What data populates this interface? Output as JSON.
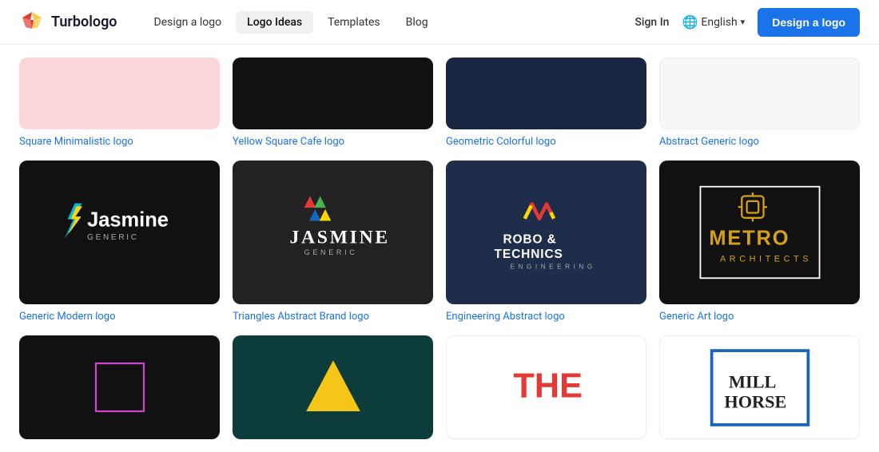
{
  "header": {
    "brand": "Turbologo",
    "nav": [
      {
        "id": "design",
        "label": "Design a logo",
        "active": false
      },
      {
        "id": "logo-ideas",
        "label": "Logo Ideas",
        "active": true
      },
      {
        "id": "templates",
        "label": "Templates",
        "active": false
      },
      {
        "id": "blog",
        "label": "Blog",
        "active": false
      }
    ],
    "sign_in": "Sign In",
    "language": "English",
    "cta": "Design a logo"
  },
  "grid": {
    "rows": [
      [
        {
          "id": "square-minimalistic",
          "title": "Square Minimalistic logo",
          "bg": "#f9d7da",
          "style": "pink"
        },
        {
          "id": "yellow-square-cafe",
          "title": "Yellow Square Cafe logo",
          "bg": "#111",
          "style": "black-simple"
        },
        {
          "id": "geometric-colorful",
          "title": "Geometric Colorful logo",
          "bg": "#1a2540",
          "style": "dark-navy"
        },
        {
          "id": "abstract-generic",
          "title": "Abstract Generic logo",
          "bg": "#fff",
          "style": "white"
        }
      ],
      [
        {
          "id": "generic-modern",
          "title": "Generic Modern logo",
          "bg": "#111",
          "style": "jasmine-dark"
        },
        {
          "id": "triangles-abstract",
          "title": "Triangles Abstract Brand logo",
          "bg": "#222",
          "style": "jasmine-generic"
        },
        {
          "id": "engineering-abstract",
          "title": "Engineering Abstract logo",
          "bg": "#1e2d4a",
          "style": "robo"
        },
        {
          "id": "generic-art",
          "title": "Generic Art logo",
          "bg": "#111",
          "style": "metro"
        }
      ],
      [
        {
          "id": "partial-1",
          "title": "",
          "bg": "#111",
          "style": "partial-square"
        },
        {
          "id": "partial-2",
          "title": "",
          "bg": "#0d3d3a",
          "style": "partial-triangle"
        },
        {
          "id": "partial-3",
          "title": "",
          "bg": "#fff",
          "style": "partial-the"
        },
        {
          "id": "partial-4",
          "title": "",
          "bg": "#fff",
          "style": "partial-mill"
        }
      ]
    ]
  }
}
